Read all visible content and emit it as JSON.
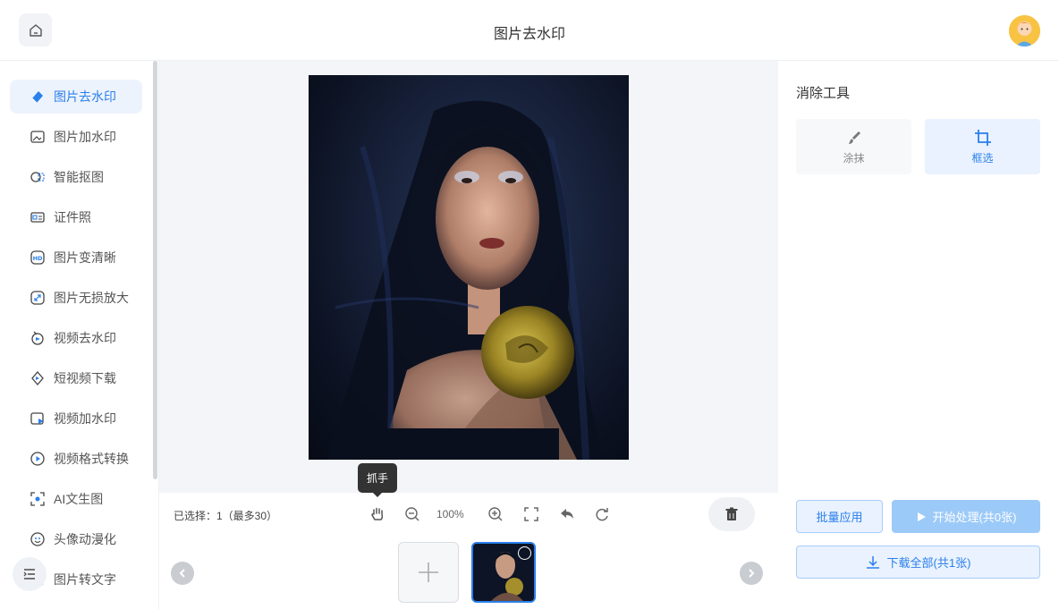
{
  "header": {
    "title": "图片去水印"
  },
  "sidebar": {
    "items": [
      {
        "label": "图片去水印",
        "icon": "eraser-icon"
      },
      {
        "label": "图片加水印",
        "icon": "image-add-icon"
      },
      {
        "label": "智能抠图",
        "icon": "cutout-icon"
      },
      {
        "label": "证件照",
        "icon": "id-card-icon"
      },
      {
        "label": "图片变清晰",
        "icon": "hd-icon"
      },
      {
        "label": "图片无损放大",
        "icon": "enlarge-icon"
      },
      {
        "label": "视频去水印",
        "icon": "video-eraser-icon"
      },
      {
        "label": "短视频下载",
        "icon": "short-video-icon"
      },
      {
        "label": "视频加水印",
        "icon": "video-watermark-icon"
      },
      {
        "label": "视频格式转换",
        "icon": "video-convert-icon"
      },
      {
        "label": "AI文生图",
        "icon": "ai-image-icon"
      },
      {
        "label": "头像动漫化",
        "icon": "anime-avatar-icon"
      },
      {
        "label": "图片转文字",
        "icon": "ocr-icon"
      }
    ]
  },
  "canvas": {
    "tooltip": "抓手",
    "selected_text": "已选择：1（最多30）",
    "zoom_level": "100%"
  },
  "tools": {
    "title": "消除工具",
    "items": [
      {
        "label": "涂抹",
        "icon": "brush-icon"
      },
      {
        "label": "框选",
        "icon": "crop-icon"
      }
    ],
    "active": "框选"
  },
  "actions": {
    "batch_apply": "批量应用",
    "start_process": "开始处理(共0张)",
    "download_all": "下载全部(共1张)"
  },
  "colors": {
    "accent": "#2b7fea",
    "accent_light": "#e9f2fe",
    "disabled_button": "#9ccaf8"
  }
}
